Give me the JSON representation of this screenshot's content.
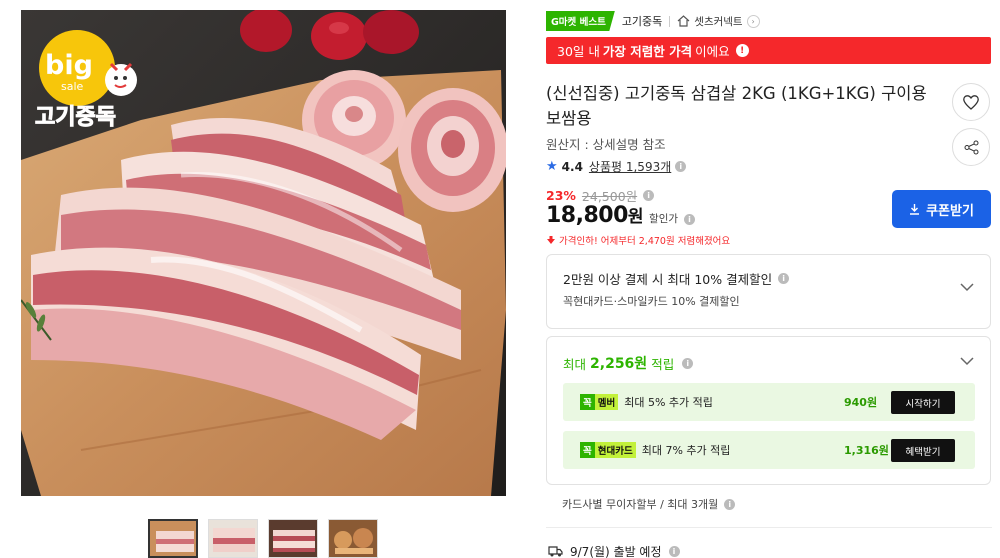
{
  "image": {
    "logo_top": "big",
    "logo_sub": "sale",
    "logo_brand": "고기중독",
    "thumbnails": [
      "thumb-1",
      "thumb-2",
      "thumb-3",
      "thumb-4"
    ]
  },
  "badges": {
    "gmarket_best": "G마켓 베스트",
    "store_name": "고기중독",
    "connect_label": "셋츠커넥트"
  },
  "banner": {
    "prefix": "30일 내 ",
    "highlight": "가장 저렴한 가격",
    "suffix": "이에요"
  },
  "product": {
    "title": "(신선집중) 고기중독 삼겹살 2KG (1KG+1KG) 구이용 보쌈용",
    "origin": "원산지 : 상세설명 참조",
    "rating": "4.4",
    "review_label": "상품평 1,593개",
    "discount_rate": "23%",
    "original_price": "24,500원",
    "price": "18,800",
    "price_unit": "원",
    "price_label": "할인가",
    "price_drop": "가격인하! 어제부터 2,470원 저렴해졌어요",
    "coupon_label": "쿠폰받기"
  },
  "card_discount": {
    "title": "2만원 이상 결제 시 최대 10% 결제할인",
    "subtitle": "꼭현대카드·스마일카드 10% 결제할인"
  },
  "points": {
    "prefix": "최대 ",
    "amount": "2,256원",
    "suffix": " 적립",
    "rewards": [
      {
        "badge_a": "꼭",
        "badge_b": "멤버",
        "text": "최대 5% 추가 적립",
        "value": "940원",
        "button": "시작하기"
      },
      {
        "badge_a": "꼭",
        "badge_b": "현대카드",
        "text": "최대 7% 추가 적립",
        "value": "1,316원",
        "button": "혜택받기"
      }
    ]
  },
  "installment": "카드사별 무이자할부 / 최대 3개월",
  "shipping": "9/7(월) 출발 예정",
  "colors": {
    "accent_red": "#f5282b",
    "accent_green": "#2db400",
    "coupon_blue": "#1b62e6"
  }
}
